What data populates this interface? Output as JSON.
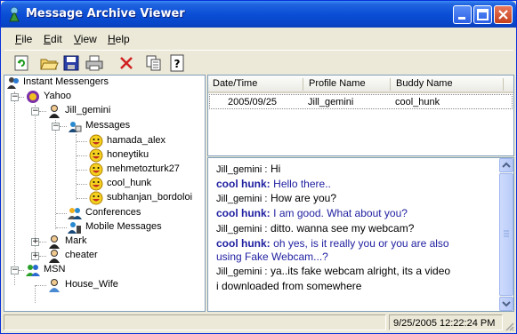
{
  "window": {
    "title": "Message Archive Viewer"
  },
  "menu": [
    "File",
    "Edit",
    "View",
    "Help"
  ],
  "toolbar_icons": [
    "refresh-icon",
    "open-folder-icon",
    "save-icon",
    "print-icon",
    "delete-icon",
    "copy-icon",
    "help-icon"
  ],
  "tree": {
    "root": "Instant Messengers",
    "yahoo": "Yahoo",
    "profile": "Jill_gemini",
    "messages": "Messages",
    "buddies": [
      "hamada_alex",
      "honeytiku",
      "mehmetozturk27",
      "cool_hunk",
      "subhanjan_bordoloi"
    ],
    "conferences": "Conferences",
    "mobile": "Mobile Messages",
    "mark": "Mark",
    "cheater": "cheater",
    "msn": "MSN",
    "house_wife": "House_Wife"
  },
  "grid": {
    "columns": [
      "Date/Time",
      "Profile Name",
      "Buddy Name"
    ],
    "rows": [
      [
        "2005/09/25",
        "Jill_gemini",
        "cool_hunk"
      ]
    ]
  },
  "chat": [
    {
      "who": "Jill_gemini :",
      "text": "Hi",
      "buddy": false
    },
    {
      "who": "cool hunk:",
      "text": "Hello there..",
      "buddy": true
    },
    {
      "who": "Jill_gemini :",
      "text": "How are you?",
      "buddy": false
    },
    {
      "who": "cool hunk:",
      "text": "I am good. What about you?",
      "buddy": true
    },
    {
      "who": "Jill_gemini :",
      "text": "ditto. wanna see my webcam?",
      "buddy": false
    },
    {
      "who": "cool hunk:",
      "text": "oh yes, is it really you or you are also",
      "buddy": true
    },
    {
      "who": "",
      "text": "using Fake Webcam...?",
      "buddy": true
    },
    {
      "who": "Jill_gemini :",
      "text": "ya..its fake webcam alright, its a video",
      "buddy": false
    },
    {
      "who": "",
      "text": "i downloaded from somewhere",
      "buddy": false
    }
  ],
  "status": {
    "datetime": "9/25/2005 12:22:24 PM"
  },
  "colors": {
    "titlebar": "#0a4fd6",
    "buddy_text": "#1e1ea0",
    "chrome": "#ece9d8"
  }
}
